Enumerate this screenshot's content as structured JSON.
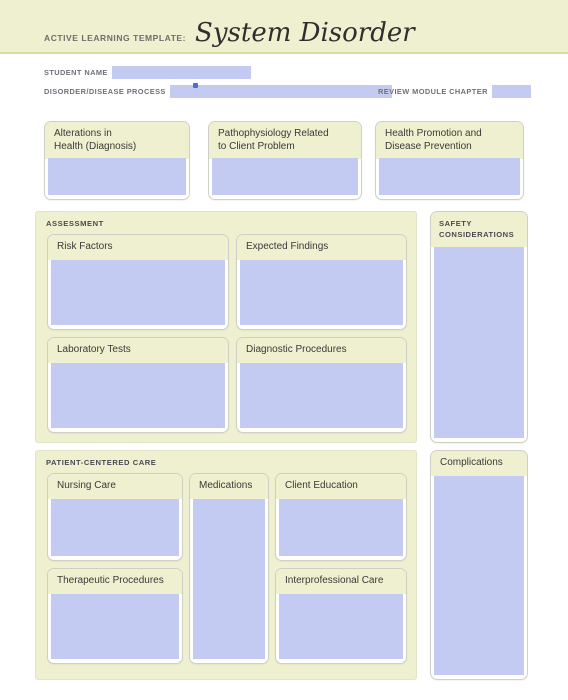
{
  "header": {
    "kicker": "ACTIVE LEARNING TEMPLATE:",
    "title": "System Disorder",
    "band_color": "#eef0cf",
    "rule_color": "#d7dca0"
  },
  "form": {
    "student_name_label": "STUDENT NAME",
    "student_name_value": "",
    "disorder_label": "DISORDER/DISEASE PROCESS",
    "disorder_value": "",
    "chapter_label": "REVIEW MODULE CHAPTER",
    "chapter_value": "",
    "field_fill_color": "#c3cbf2",
    "caret_color": "#4b6fd4"
  },
  "top_boxes": [
    {
      "title": "Alterations in\nHealth (Diagnosis)",
      "value": ""
    },
    {
      "title": "Pathophysiology Related\nto Client Problem",
      "value": ""
    },
    {
      "title": "Health Promotion and\nDisease Prevention",
      "value": ""
    }
  ],
  "assessment": {
    "section_label": "ASSESSMENT",
    "boxes": [
      {
        "title": "Risk Factors",
        "value": ""
      },
      {
        "title": "Expected Findings",
        "value": ""
      },
      {
        "title": "Laboratory Tests",
        "value": ""
      },
      {
        "title": "Diagnostic Procedures",
        "value": ""
      }
    ]
  },
  "safety": {
    "title": "SAFETY\nCONSIDERATIONS",
    "value": ""
  },
  "patient_centered_care": {
    "section_label": "PATIENT-CENTERED CARE",
    "boxes": [
      {
        "title": "Nursing Care",
        "value": ""
      },
      {
        "title": "Medications",
        "value": ""
      },
      {
        "title": "Client Education",
        "value": ""
      },
      {
        "title": "Therapeutic Procedures",
        "value": ""
      },
      {
        "title": "Interprofessional Care",
        "value": ""
      }
    ]
  },
  "complications": {
    "title": "Complications",
    "value": ""
  }
}
